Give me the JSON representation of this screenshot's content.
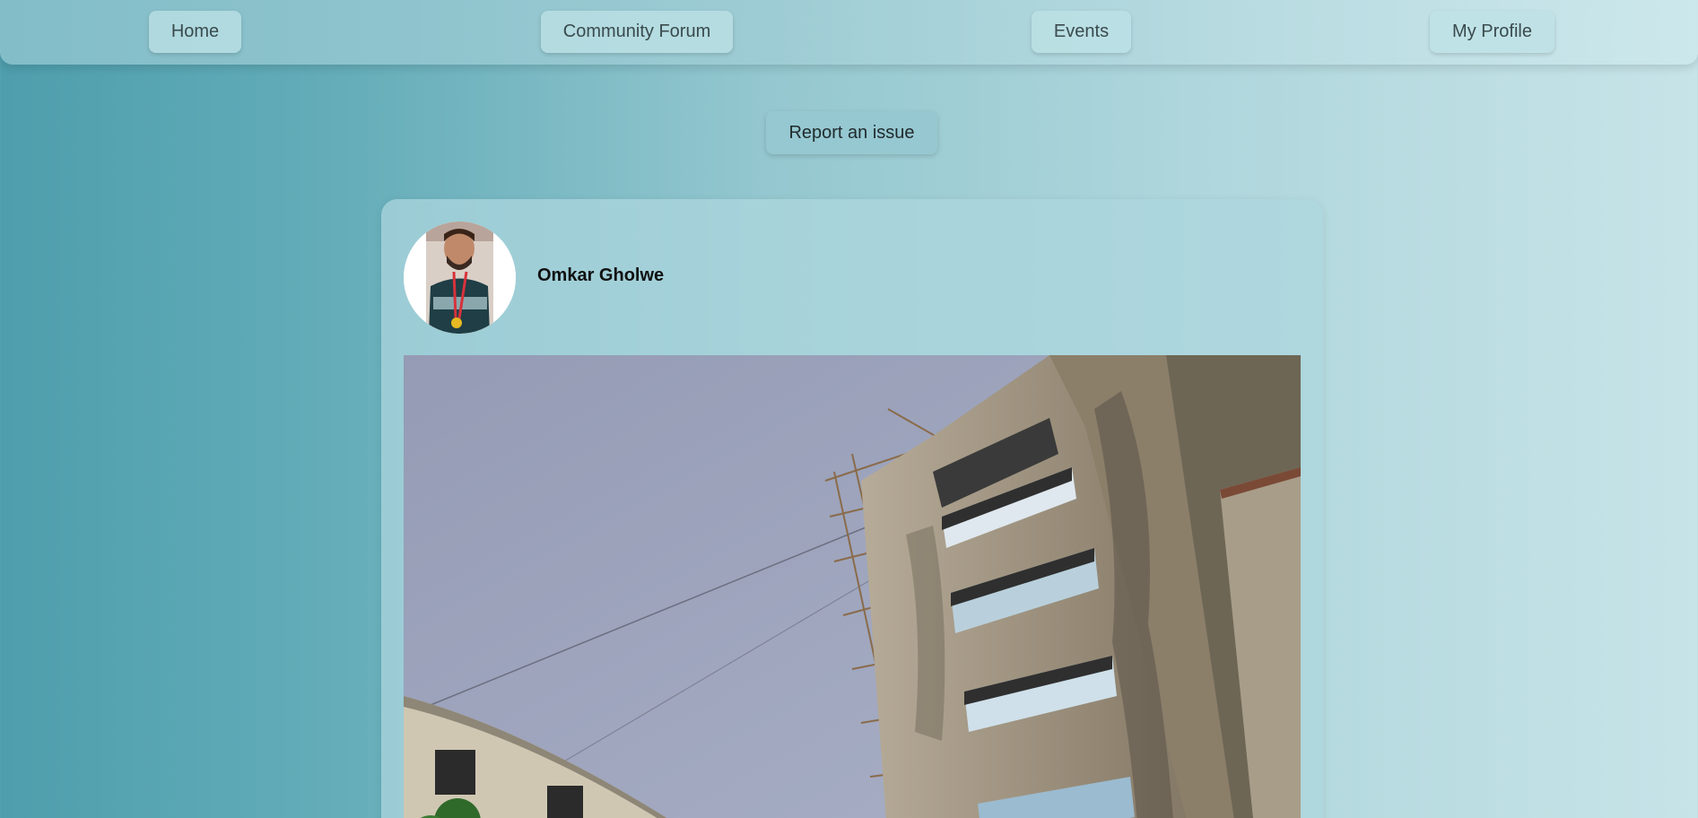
{
  "nav": {
    "items": [
      {
        "label": "Home"
      },
      {
        "label": "Community Forum"
      },
      {
        "label": "Events"
      },
      {
        "label": "My Profile"
      }
    ]
  },
  "actions": {
    "report_label": "Report an issue"
  },
  "post": {
    "author": "Omkar Gholwe",
    "image_icon": "photo-building"
  },
  "colors": {
    "gradient_start": "#4e9ead",
    "gradient_end": "#c7e4e8",
    "card_bg": "#acd6dd"
  }
}
